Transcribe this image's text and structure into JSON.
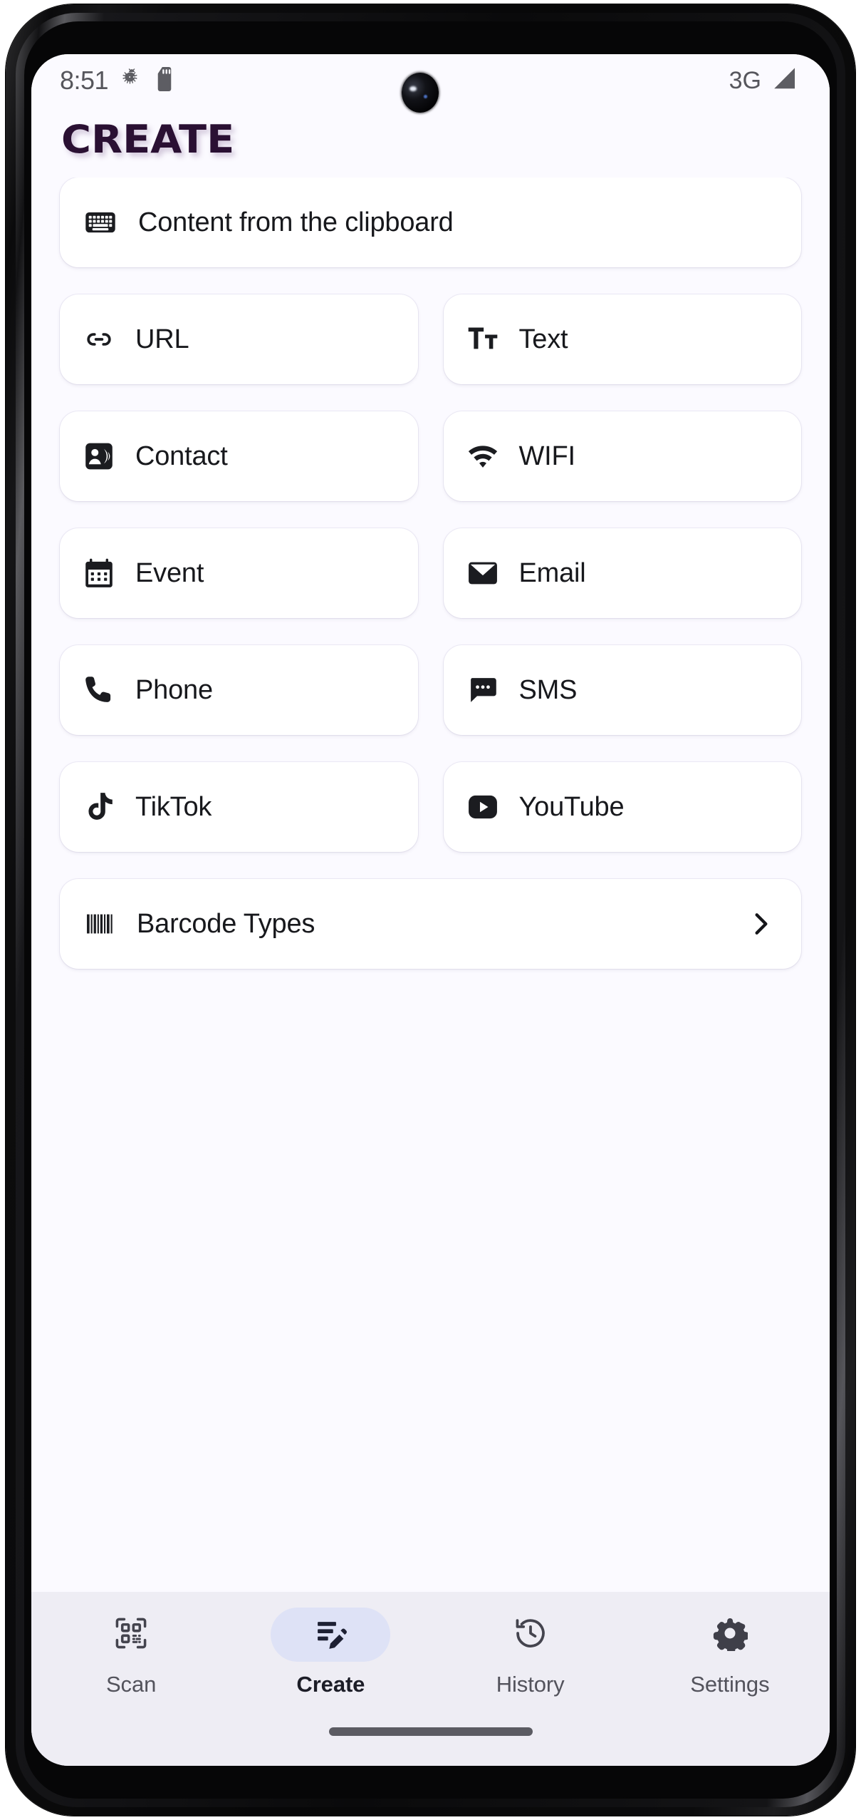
{
  "status_bar": {
    "time": "8:51",
    "left_icons": [
      "android-bug-icon",
      "sd-card-icon"
    ],
    "network": "3G",
    "right_icons": [
      "signal-bars-icon"
    ]
  },
  "header": {
    "title": "CREATE",
    "title_color": "#2a1033"
  },
  "clipboard": {
    "label": "Content from the clipboard",
    "icon": "keyboard-icon"
  },
  "grid": [
    [
      {
        "label": "URL",
        "icon": "link-icon"
      },
      {
        "label": "Text",
        "icon": "text-format-icon"
      }
    ],
    [
      {
        "label": "Contact",
        "icon": "contact-card-icon"
      },
      {
        "label": "WIFI",
        "icon": "wifi-icon"
      }
    ],
    [
      {
        "label": "Event",
        "icon": "calendar-icon"
      },
      {
        "label": "Email",
        "icon": "envelope-icon"
      }
    ],
    [
      {
        "label": "Phone",
        "icon": "phone-icon"
      },
      {
        "label": "SMS",
        "icon": "sms-bubble-icon"
      }
    ],
    [
      {
        "label": "TikTok",
        "icon": "tiktok-icon"
      },
      {
        "label": "YouTube",
        "icon": "youtube-icon"
      }
    ]
  ],
  "barcode_types": {
    "label": "Barcode Types",
    "icon": "barcode-icon",
    "chevron": "chevron-right-icon"
  },
  "bottom_nav": {
    "active": "Create",
    "active_pill_color": "#dee2f6",
    "items": [
      {
        "label": "Scan",
        "icon": "qr-scan-icon"
      },
      {
        "label": "Create",
        "icon": "create-edit-icon"
      },
      {
        "label": "History",
        "icon": "history-clock-icon"
      },
      {
        "label": "Settings",
        "icon": "gear-icon"
      }
    ]
  },
  "theme": {
    "screen_background": "#fbfaff",
    "card_background": "#ffffff",
    "nav_background": "#eeedf4",
    "text_primary": "#17181c",
    "text_secondary": "#53535c"
  }
}
